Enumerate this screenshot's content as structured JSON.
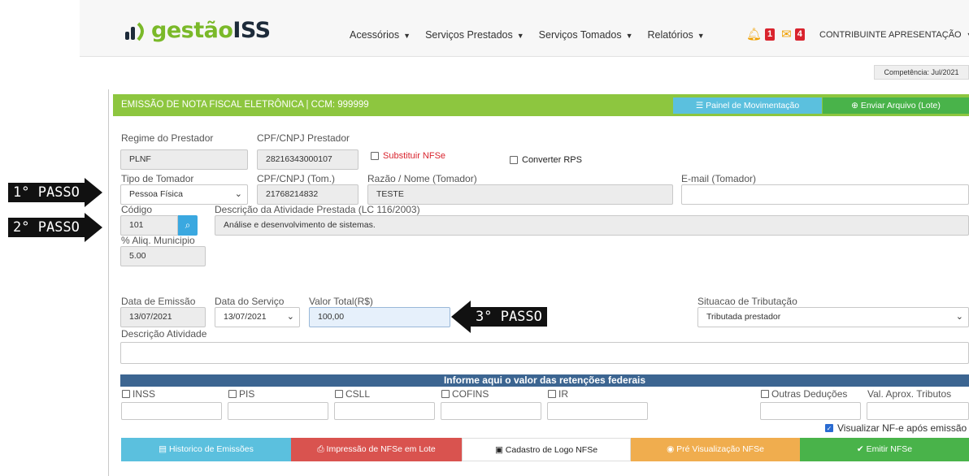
{
  "header": {
    "logo_part1": "gestão",
    "logo_part2": "ISS",
    "nav": [
      {
        "label": "Acessórios"
      },
      {
        "label": "Serviços Prestados"
      },
      {
        "label": "Serviços Tomados"
      },
      {
        "label": "Relatórios"
      }
    ],
    "notif_count": "1",
    "mail_count": "4",
    "user": "CONTRIBUINTE APRESENTAÇÃO",
    "competencia": "Competência: Jul/2021"
  },
  "panel": {
    "title": "EMISSÃO DE NOTA FISCAL ELETRÔNICA | CCM: 999999",
    "painel_btn": "Painel de Movimentação",
    "enviar_btn": "Enviar Arquivo (Lote)"
  },
  "form": {
    "regime_label": "Regime do Prestador",
    "regime_value": "PLNF",
    "cpf_prest_label": "CPF/CNPJ Prestador",
    "cpf_prest_value": "28216343000107",
    "substituir_label": "Substituir NFSe",
    "converter_label": "Converter RPS",
    "tipo_tomador_label": "Tipo de Tomador",
    "tipo_tomador_value": "Pessoa Física",
    "cpf_tom_label": "CPF/CNPJ (Tom.)",
    "cpf_tom_value": "21768214832",
    "razao_label": "Razão / Nome (Tomador)",
    "razao_value": "TESTE",
    "email_label": "E-mail (Tomador)",
    "email_value": "",
    "codigo_label": "Código",
    "codigo_value": "101",
    "descricao_ativ_label": "Descrição da Atividade Prestada (LC 116/2003)",
    "descricao_ativ_value": "Análise e desenvolvimento de sistemas.",
    "aliq_label": "% Aliq. Municipio",
    "aliq_value": "5.00",
    "data_emissao_label": "Data de Emissão",
    "data_emissao_value": "13/07/2021",
    "data_servico_label": "Data do Serviço",
    "data_servico_value": "13/07/2021",
    "valor_label": "Valor Total(R$)",
    "valor_value": "100,00",
    "situacao_label": "Situacao de Tributação",
    "situacao_value": "Tributada prestador",
    "descricao_label": "Descrição Atividade",
    "descricao_value": ""
  },
  "steps": {
    "step1": "1° PASSO",
    "step2": "2° PASSO",
    "step3": "3° PASSO"
  },
  "retencoes": {
    "title": "Informe aqui o valor das retenções federais",
    "inss": "INSS",
    "pis": "PIS",
    "csll": "CSLL",
    "cofins": "COFINS",
    "ir": "IR",
    "outras": "Outras Deduções",
    "val_aprox": "Val. Aprox. Tributos",
    "visualizar": "Visualizar NF-e após emissão"
  },
  "buttons": {
    "historico": "Historico de Emissões",
    "impressao": "Impressão de NFSe em Lote",
    "cadastro": "Cadastro de Logo NFSe",
    "pre": "Pré Visualização NFSe",
    "emitir": "Emitir NFSe"
  },
  "colors": {
    "green": "#8dc63f",
    "blue_btn": "#5bc0de",
    "red_btn": "#d9534f",
    "orange_btn": "#f0ad4e",
    "emit_btn": "#49b34a",
    "ret_bar": "#3c6591"
  }
}
